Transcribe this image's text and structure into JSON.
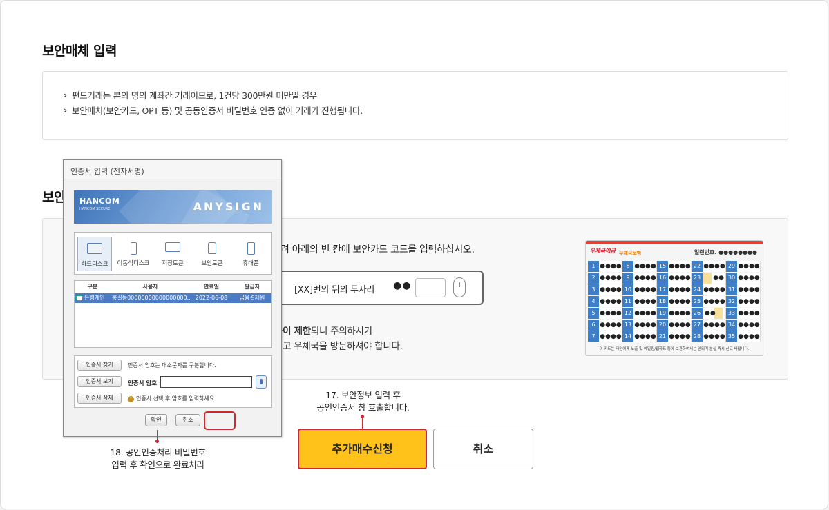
{
  "section1": {
    "title": "보안매체 입력",
    "notices": [
      "펀드거래는 본의 명의 계좌간 거래이므로, 1건당 300만원 미만일 경우",
      "보안매치(보안카드, OPT 등) 및 공동인증서 비밀번호 인증 없이 거래가 진행됩니다."
    ]
  },
  "section2": {
    "title_partial": "보안",
    "instruction": "려 아래의 빈 칸에 보안카드 코드를 입력하십시오.",
    "code_label": "[XX]번의 뒤의 두자리",
    "code_dots": "●●",
    "warn1_bold": "용이 제한",
    "warn1_rest": "되니 주의하시기",
    "warn2": "시고 우체국을 방문하셔야 합니다."
  },
  "security_card": {
    "logo": "우체국예금",
    "logo2": "우체국보험",
    "serial": "일련번호. ●●●●●●●●",
    "masked": "●●●●",
    "columns": [
      [
        1,
        2,
        3,
        4,
        5,
        6,
        7
      ],
      [
        8,
        9,
        10,
        11,
        12,
        13,
        14
      ],
      [
        15,
        16,
        17,
        18,
        19,
        20,
        21
      ],
      [
        22,
        23,
        24,
        25,
        26,
        27,
        28
      ],
      [
        29,
        30,
        31,
        32,
        33,
        34,
        35
      ]
    ],
    "partial": "●●",
    "footer": "이 카드는 타인에게 노출 및 예일링/웹하드 등에 보관하여서는 안되며 분실 즉시 신고 바랍니다."
  },
  "dialog": {
    "title": "인증서 입력 (전자서명)",
    "banner": {
      "brand": "HANCOM",
      "brand_sub": "HANCOM SECURE",
      "product": "ANYSIGN"
    },
    "media": [
      {
        "label": "하드디스크",
        "icon": "hard-disk-icon"
      },
      {
        "label": "이동식디스크",
        "icon": "usb-icon"
      },
      {
        "label": "저장토큰",
        "icon": "token-icon"
      },
      {
        "label": "보안토큰",
        "icon": "security-token-icon"
      },
      {
        "label": "휴대폰",
        "icon": "phone-icon"
      }
    ],
    "table": {
      "headers": [
        "구분",
        "사용자",
        "만료일",
        "발급자"
      ],
      "rows": [
        [
          "은행개인",
          "홍길동00000000000000000..",
          "2022-06-08",
          "금융결제원"
        ]
      ]
    },
    "find_btn": "인증서 찾기",
    "find_txt": "인증서 암호는 대소문자를 구분합니다.",
    "view_btn": "인증서 보기",
    "pw_label": "인증서 암호",
    "delete_btn": "인증서 삭제",
    "hint": "인증서 선택 후 암호를 입력하세요.",
    "ok": "확인",
    "cancel": "취소"
  },
  "callouts": {
    "c17_line1": "17. 보안정보 입력 후",
    "c17_line2": "공인인증서 창 호출합니다.",
    "c18_line1": "18. 공인인증처리 비밀번호",
    "c18_line2": "입력 후 확인으로 완료처리"
  },
  "buttons": {
    "primary": "추가매수신청",
    "cancel": "취소"
  },
  "colors": {
    "accent": "#ffc21a",
    "highlight": "#d0282e",
    "card_blue": "#3d7ec9"
  }
}
